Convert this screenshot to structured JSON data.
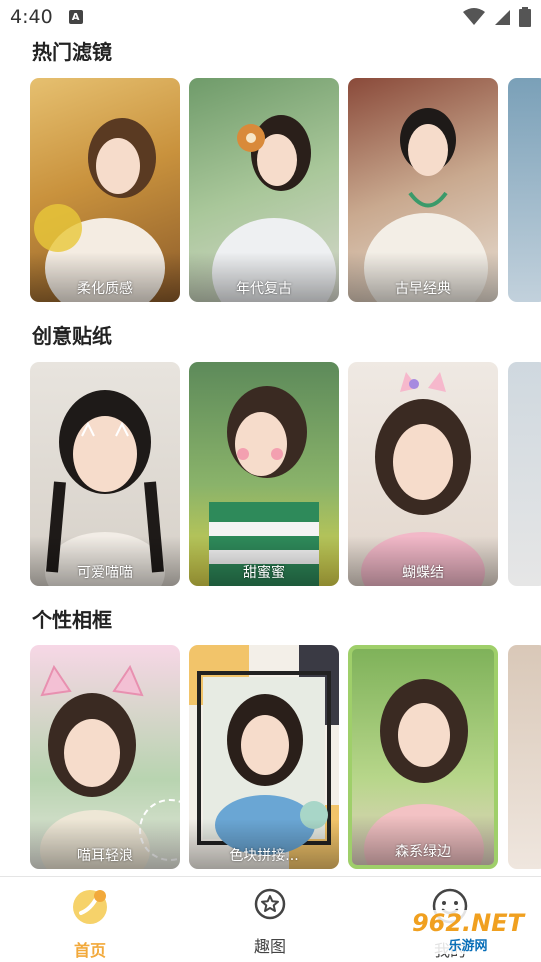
{
  "status_bar": {
    "time": "4:40",
    "notification_glyph": "A"
  },
  "sections": [
    {
      "title": "热门滤镜",
      "cards": [
        {
          "label": "柔化质感"
        },
        {
          "label": "年代复古"
        },
        {
          "label": "古早经典"
        }
      ]
    },
    {
      "title": "创意贴纸",
      "cards": [
        {
          "label": "可爱喵喵"
        },
        {
          "label": "甜蜜蜜"
        },
        {
          "label": "蝴蝶结"
        }
      ]
    },
    {
      "title": "个性相框",
      "cards": [
        {
          "label": "喵耳轻浪"
        },
        {
          "label": "色块拼接..."
        },
        {
          "label": "森系绿边"
        }
      ]
    }
  ],
  "tabs": [
    {
      "label": "首页",
      "icon": "home-banana-icon",
      "active": true
    },
    {
      "label": "趣图",
      "icon": "star-circle-icon",
      "active": false
    },
    {
      "label": "我的",
      "icon": "smiley-icon",
      "active": false
    }
  ],
  "watermark": {
    "top": "962.NET",
    "bottom": "乐游网"
  },
  "colors": {
    "active_tab": "#f2a93b",
    "inactive_tab": "#444444"
  }
}
